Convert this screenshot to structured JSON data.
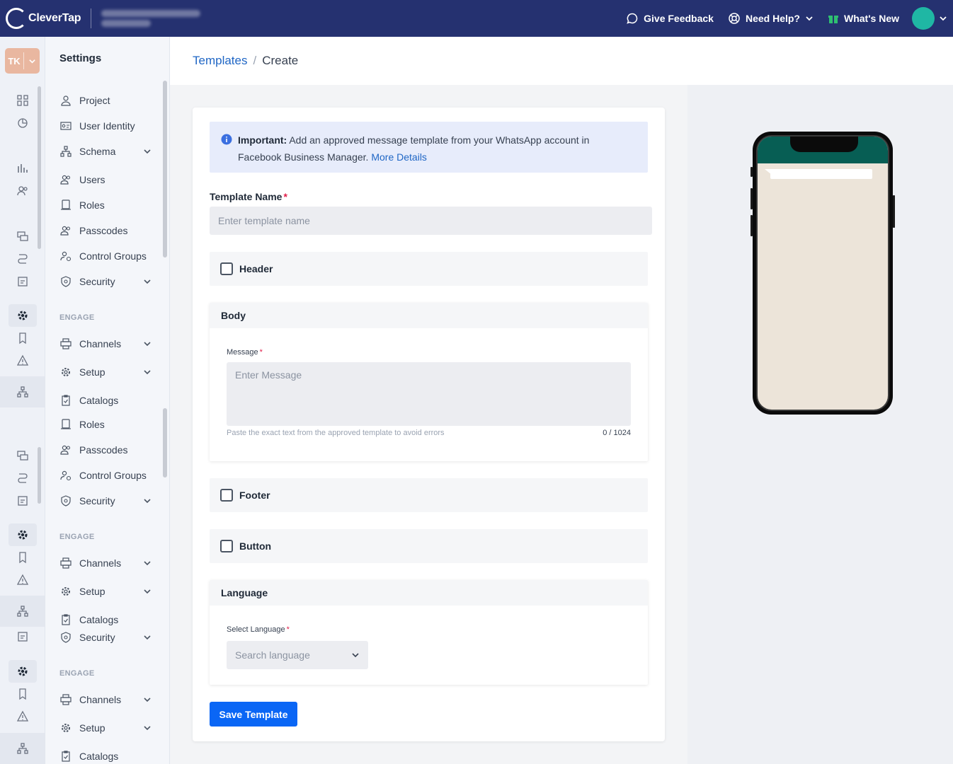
{
  "topbar": {
    "brand": "CleverTap",
    "give_feedback": "Give Feedback",
    "need_help": "Need Help?",
    "whats_new": "What's New",
    "colors": {
      "bar": "#253170",
      "avatar": "#1fb7a4"
    }
  },
  "user": {
    "initials": "TK"
  },
  "sidebar": {
    "title": "Settings",
    "items": [
      {
        "label": "Project",
        "icon": "user-icon"
      },
      {
        "label": "User Identity",
        "icon": "id-card-icon"
      },
      {
        "label": "Schema",
        "icon": "schema-icon",
        "expandable": true
      },
      {
        "label": "Users",
        "icon": "users-icon"
      },
      {
        "label": "Roles",
        "icon": "roles-icon"
      },
      {
        "label": "Passcodes",
        "icon": "passcodes-icon"
      },
      {
        "label": "Control Groups",
        "icon": "control-groups-icon"
      },
      {
        "label": "Security",
        "icon": "shield-icon",
        "expandable": true
      },
      {
        "label": "Channels",
        "icon": "channels-icon",
        "expandable": true
      },
      {
        "label": "Setup",
        "icon": "gear-icon",
        "expandable": true
      },
      {
        "label": "Catalogs",
        "icon": "catalog-icon"
      },
      {
        "label": "Roles",
        "icon": "roles-icon"
      },
      {
        "label": "Passcodes",
        "icon": "passcodes-icon"
      },
      {
        "label": "Control Groups",
        "icon": "control-groups-icon"
      },
      {
        "label": "Security",
        "icon": "shield-icon",
        "expandable": true
      },
      {
        "label": "Channels",
        "icon": "channels-icon",
        "expandable": true
      },
      {
        "label": "Setup",
        "icon": "gear-icon",
        "expandable": true
      },
      {
        "label": "Catalogs",
        "icon": "catalog-icon"
      },
      {
        "label": "Security",
        "icon": "shield-icon",
        "expandable": true
      },
      {
        "label": "Channels",
        "icon": "channels-icon",
        "expandable": true
      },
      {
        "label": "Setup",
        "icon": "gear-icon",
        "expandable": true
      },
      {
        "label": "Catalogs",
        "icon": "catalog-icon"
      }
    ],
    "section_label": "ENGAGE"
  },
  "breadcrumb": {
    "parent": "Templates",
    "separator": "/",
    "current": "Create"
  },
  "notice": {
    "bold": "Important:",
    "text": " Add an approved message template from your WhatsApp account in Facebook Business Manager.",
    "link": "More Details"
  },
  "form": {
    "template_name_label": "Template Name",
    "template_name_placeholder": "Enter template name",
    "template_name_value": "",
    "header_label": "Header",
    "body_label": "Body",
    "message_label": "Message",
    "message_placeholder": "Enter Message",
    "message_hint": "Paste the exact text from the approved template to avoid errors",
    "message_counter": "0 / 1024",
    "footer_label": "Footer",
    "button_label": "Button",
    "language_label": "Language",
    "select_language_label": "Select Language",
    "select_language_placeholder": "Search language",
    "required_mark": "*",
    "save_label": "Save Template",
    "colors": {
      "primary": "#0a66f5",
      "link": "#1f66c5",
      "notice_bg": "#e7ecfb"
    }
  }
}
